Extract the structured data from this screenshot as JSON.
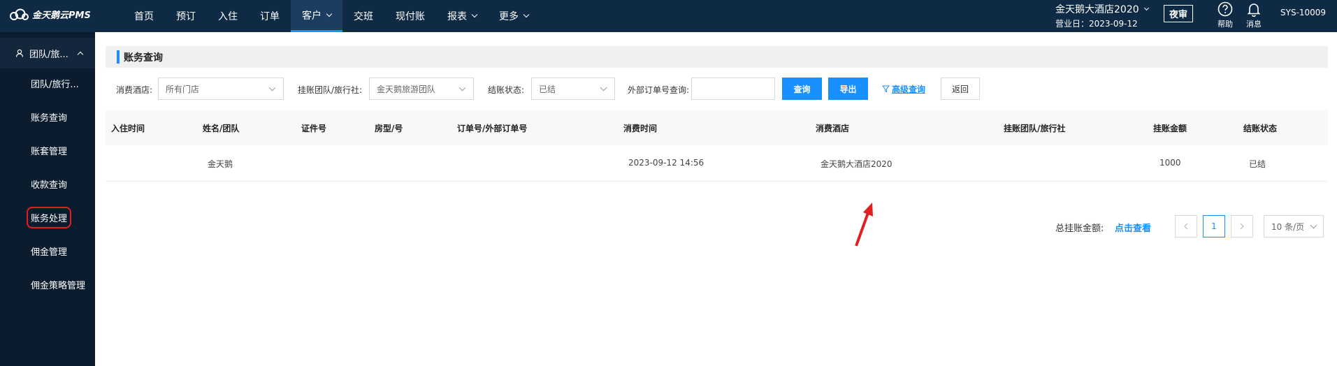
{
  "app": {
    "logo_text": "金天鹅云PMS"
  },
  "nav": {
    "items": [
      {
        "label": "首页"
      },
      {
        "label": "预订"
      },
      {
        "label": "入住"
      },
      {
        "label": "订单"
      },
      {
        "label": "客户",
        "active": true
      },
      {
        "label": "交班"
      },
      {
        "label": "现付账"
      },
      {
        "label": "报表"
      },
      {
        "label": "更多"
      }
    ]
  },
  "header": {
    "hotel_name": "金天鹅大酒店2020",
    "business_day": "营业日：2023-09-12",
    "night_audit": "夜审",
    "help": "帮助",
    "messages": "消息",
    "user": "SYS-10009"
  },
  "sidebar": {
    "group": "团队/旅...",
    "items": [
      {
        "label": "团队/旅行..."
      },
      {
        "label": "账务查询"
      },
      {
        "label": "账套管理"
      },
      {
        "label": "收款查询"
      },
      {
        "label": "账务处理",
        "highlighted": true
      },
      {
        "label": "佣金管理"
      },
      {
        "label": "佣金策略管理"
      }
    ]
  },
  "main": {
    "section_title": "账务查询",
    "filters": {
      "hotel_label": "消费酒店:",
      "hotel_value": "所有门店",
      "group_label": "挂账团队/旅行社:",
      "group_value": "金天鹅旅游团队",
      "status_label": "结账状态:",
      "status_value": "已结",
      "order_label": "外部订单号查询:",
      "order_value": "",
      "search_button": "查询",
      "export_button": "导出",
      "advanced": "高级查询",
      "back_button": "返回"
    },
    "table": {
      "headers": [
        "入住时间",
        "姓名/团队",
        "证件号",
        "房型/号",
        "订单号/外部订单号",
        "消费时间",
        "消费酒店",
        "挂账团队/旅行社",
        "挂账金额",
        "结账状态"
      ],
      "rows": [
        [
          "",
          "金天鹅",
          "",
          "",
          "",
          "2023-09-12 14:56",
          "金天鹅大酒店2020",
          "",
          "1000",
          "已结"
        ]
      ]
    },
    "footer": {
      "total_label": "总挂账金额:",
      "total_link": "点击查看",
      "current_page": "1",
      "page_size": "10 条/页"
    }
  },
  "colors": {
    "topbar": "#0f2a44",
    "sidebar": "#0a1c2e",
    "accent": "#1890ff",
    "highlight": "#e02020"
  }
}
